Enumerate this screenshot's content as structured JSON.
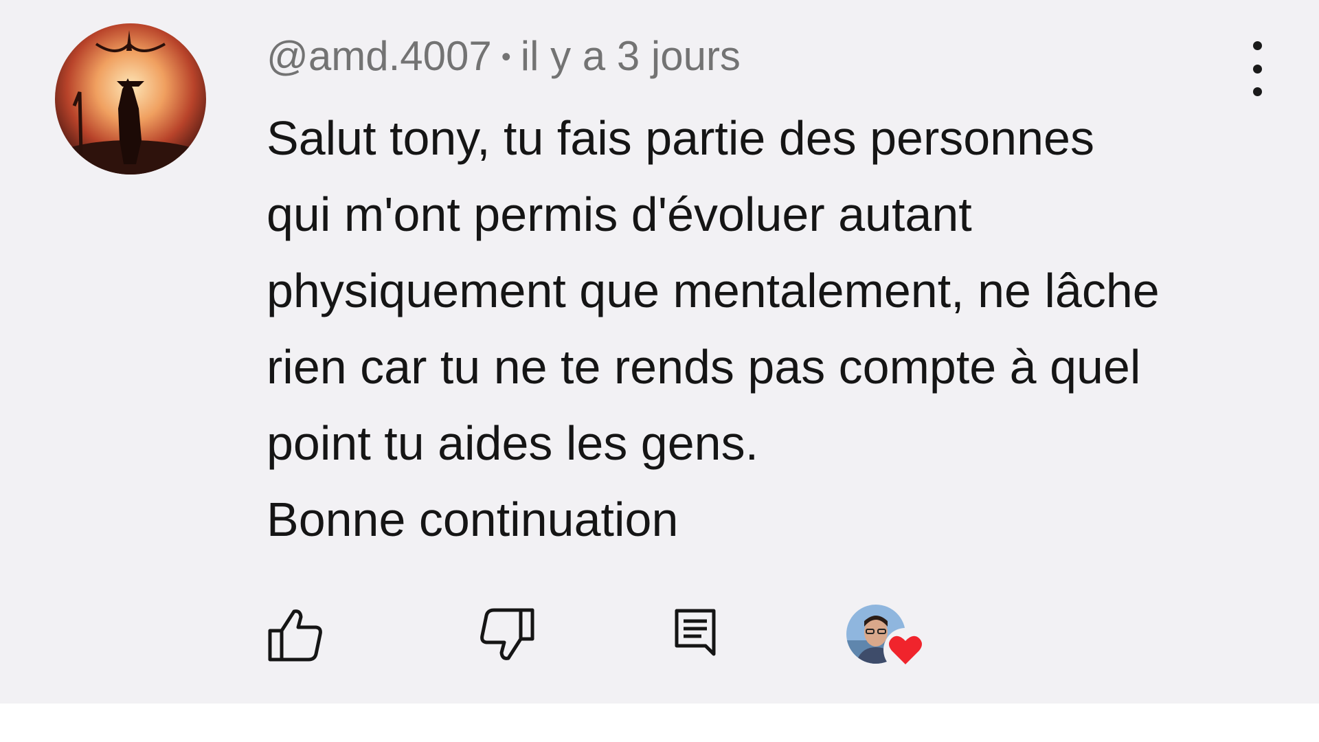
{
  "comment": {
    "author": "@amd.4007",
    "separator": "•",
    "time": "il y a 3 jours",
    "lines": [
      "Salut tony, tu fais partie des personnes",
      "qui m'ont permis d'évoluer autant",
      "physiquement que mentalement, ne lâche",
      "rien car tu ne te rends pas compte à quel",
      "point tu aides les gens.",
      "Bonne continuation"
    ]
  },
  "icons": {
    "more": "more-vertical-icon",
    "like": "thumbs-up-icon",
    "dislike": "thumbs-down-icon",
    "reply": "reply-comment-icon",
    "heart": "heart-icon"
  },
  "colors": {
    "background": "#f2f1f4",
    "text": "#151515",
    "meta_text": "#737373",
    "heart": "#f0242c"
  }
}
